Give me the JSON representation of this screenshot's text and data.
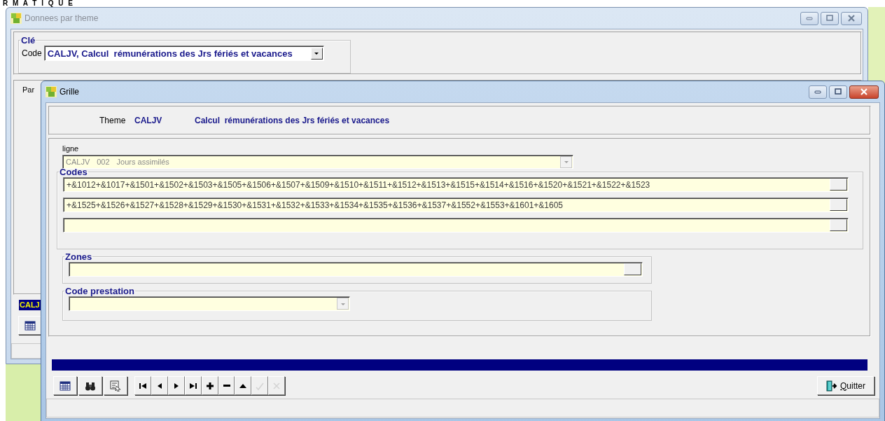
{
  "desktop": {
    "heading": "R M A T I Q U E"
  },
  "back_window": {
    "title": "Donnees par theme",
    "active": false,
    "key_group": {
      "label": "Clé",
      "code_label": "Code",
      "code_value": "CALJV, Calcul  rémunérations des Jrs fériés et vacances"
    },
    "panel_label": "Par",
    "record_label": "CALJ",
    "toolbar": [
      {
        "kind": "grid",
        "disabled": false
      }
    ]
  },
  "grille_window": {
    "title": "Grille",
    "active": true,
    "theme": {
      "label": "Theme",
      "code": "CALJV",
      "name": "Calcul  rémunérations des Jrs fériés et vacances"
    },
    "ligne": {
      "label": "ligne",
      "code": "CALJV",
      "number": "002",
      "name": "Jours assimilés",
      "disabled": true
    },
    "codes": {
      "label": "Codes",
      "fields": [
        {
          "kind": "text",
          "value": "+&1012+&1017+&1501+&1502+&1503+&1505+&1506+&1507+&1509+&1510+&1511+&1512+&1513+&1515+&1514+&1516+&1520+&1521+&1522+&1523"
        },
        {
          "kind": "text",
          "value": "+&1525+&1526+&1527+&1528+&1529+&1530+&1531+&1532+&1533+&1534+&1535+&1536+&1537+&1552+&1553+&1601+&1605"
        },
        {
          "kind": "blank"
        }
      ]
    },
    "zones": {
      "label": "Zones"
    },
    "code_prestation": {
      "label": "Code prestation"
    },
    "toolbar": [
      {
        "kind": "grid",
        "disabled": false
      },
      {
        "kind": "search",
        "disabled": false
      },
      {
        "kind": "form",
        "disabled": false
      },
      {
        "kind": "first",
        "disabled": false
      },
      {
        "kind": "prev",
        "disabled": false
      },
      {
        "kind": "next",
        "disabled": false
      },
      {
        "kind": "last",
        "disabled": false
      },
      {
        "kind": "add",
        "disabled": false
      },
      {
        "kind": "remove",
        "disabled": false
      },
      {
        "kind": "up",
        "disabled": false
      },
      {
        "kind": "confirm",
        "disabled": true
      },
      {
        "kind": "cancel",
        "disabled": true
      }
    ],
    "quit_button": {
      "label": "Quitter"
    }
  }
}
